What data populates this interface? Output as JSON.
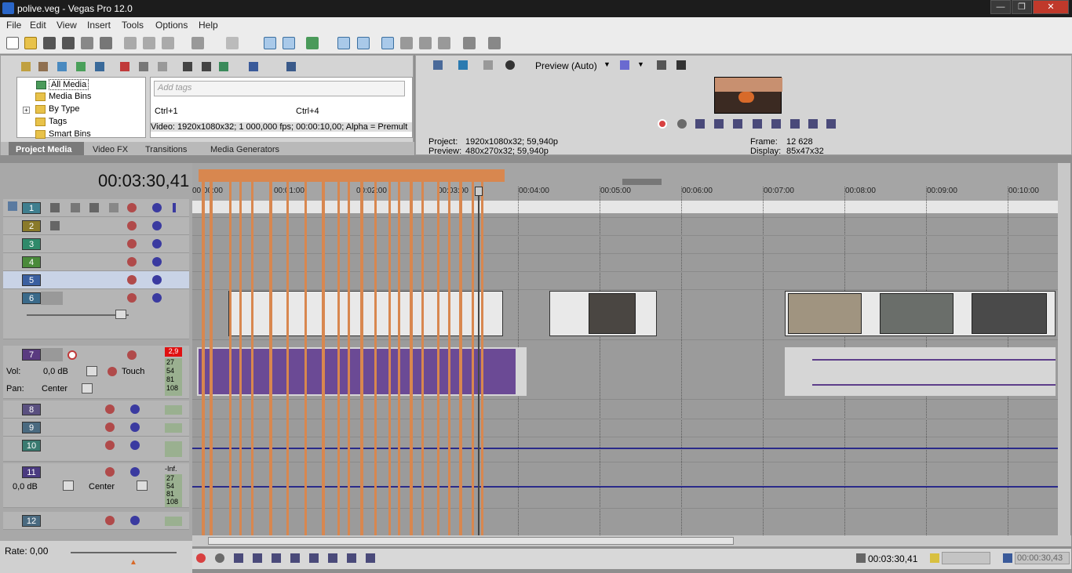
{
  "window": {
    "title": "polive.veg - Vegas Pro 12.0"
  },
  "menu": [
    "File",
    "Edit",
    "View",
    "Insert",
    "Tools",
    "Options",
    "Help"
  ],
  "explorer": {
    "tree": [
      "All Media",
      "Media Bins",
      "By Type",
      "Tags",
      "Smart Bins"
    ],
    "tag_placeholder": "Add tags",
    "shortcut_1": "Ctrl+1",
    "shortcut_2": "Ctrl+4",
    "info": "Video: 1920x1080x32; 1 000,000 fps; 00:00:10,00; Alpha = Premult",
    "tabs": [
      "Project Media",
      "Video FX",
      "Transitions",
      "Media Generators"
    ]
  },
  "preview": {
    "mode": "Preview (Auto)",
    "project_label": "Project:",
    "project_value": "1920x1080x32; 59,940p",
    "preview_label": "Preview:",
    "preview_value": "480x270x32; 59,940p",
    "frame_label": "Frame:",
    "frame_value": "12 628",
    "display_label": "Display:",
    "display_value": "85x47x32"
  },
  "timecode": "00:03:30,41",
  "ruler": [
    "00:00:00",
    "00:01:00",
    "00:02:00",
    "00:03:00",
    "00:04:00",
    "00:05:00",
    "00:06:00",
    "00:07:00",
    "00:08:00",
    "00:09:00",
    "00:10:00"
  ],
  "tracks": {
    "video": [
      {
        "num": "1",
        "color": "#3f7f8f"
      },
      {
        "num": "2",
        "color": "#8a7a2a"
      },
      {
        "num": "3",
        "color": "#2f8a6a"
      },
      {
        "num": "4",
        "color": "#4a8a3a"
      },
      {
        "num": "5",
        "color": "#3a5fa0"
      },
      {
        "num": "6",
        "color": "#3a6a8a"
      }
    ],
    "audio7": {
      "num": "7",
      "meter_peak": "2,9",
      "vol_label": "Vol:",
      "vol_value": "0,0 dB",
      "pan_label": "Pan:",
      "pan_value": "Center",
      "touch": "Touch",
      "meter_ticks": [
        "27",
        "54",
        "81",
        "108"
      ]
    },
    "audio": [
      {
        "num": "8",
        "color": "#5a5080"
      },
      {
        "num": "9",
        "color": "#4a6a80"
      },
      {
        "num": "10",
        "color": "#3a7a70"
      },
      {
        "num": "12",
        "color": "#4a6a80"
      }
    ],
    "audio11": {
      "num": "11",
      "vol_value": "0,0 dB",
      "pan_value": "Center",
      "meter_top": "-Inf.",
      "meter_ticks": [
        "27",
        "54",
        "81",
        "108"
      ]
    }
  },
  "rate_label": "Rate: 0,00",
  "status": {
    "cursor_time": "00:03:30,41",
    "end_time": "00:00:30,43"
  },
  "colors": {
    "orange_marker": "#d8874f",
    "audio_clip": "#6b4a95",
    "record": "#d84040",
    "titlebar": "#1c1c1c"
  }
}
